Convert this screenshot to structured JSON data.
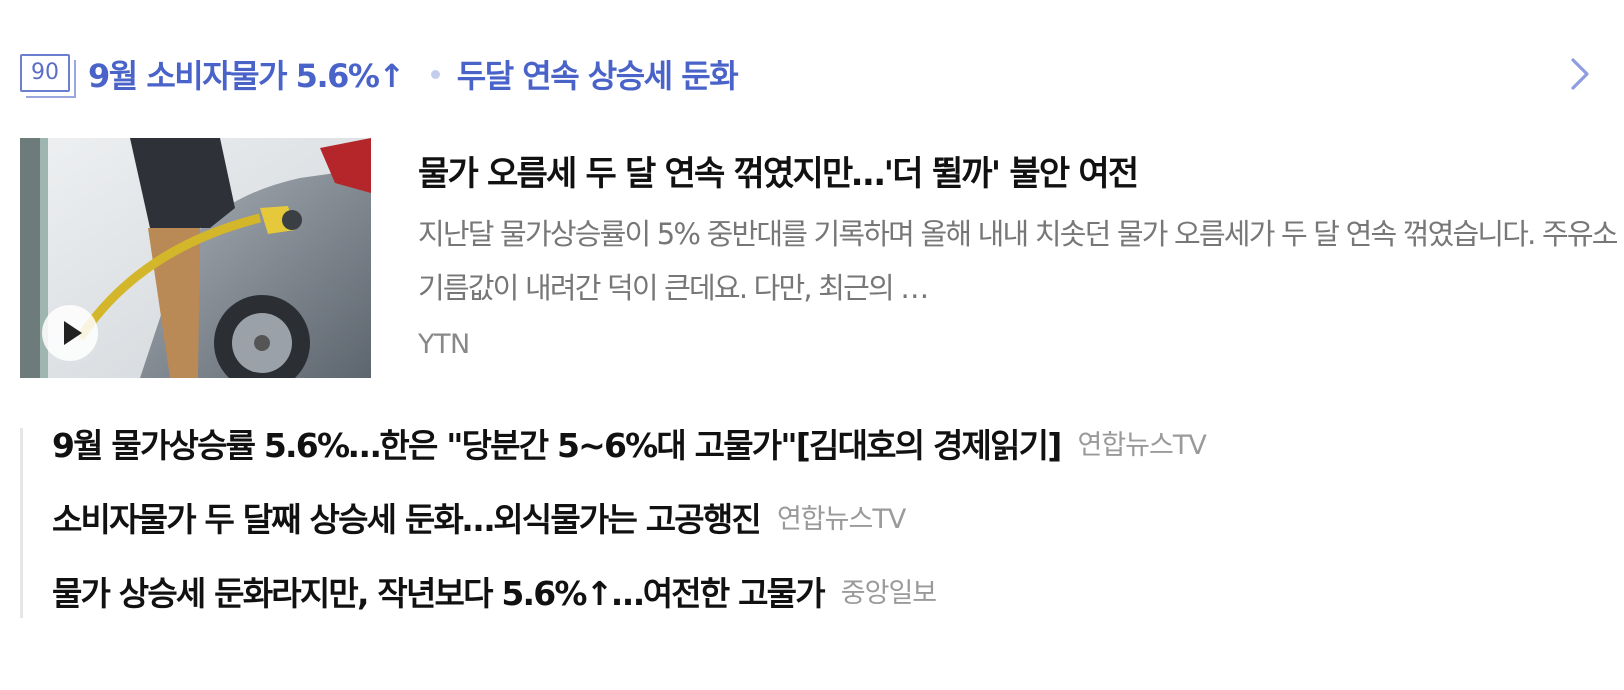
{
  "issue": {
    "badge_number": "90",
    "title": "9월 소비자물가 5.6%↑",
    "subtitle": "두달 연속 상승세 둔화",
    "accent_color": "#4a63c9",
    "more_icon": "chevron-right-icon"
  },
  "main_article": {
    "title": "물가 오름세 두 달 연속 꺾였지만…'더 뛸까' 불안 여전",
    "description": "지난달 물가상승률이 5% 중반대를 기록하며 올해 내내 치솟던 물가 오름세가 두 달 연속 꺾였습니다. 주유소 기름값이 내려간 덕이 큰데요. 다만, 최근의 …",
    "source": "YTN",
    "thumbnail_icon": "play-icon"
  },
  "related_articles": [
    {
      "title": "9월 물가상승률 5.6%…한은 \"당분간 5~6%대 고물가\"[김대호의 경제읽기]",
      "source": "연합뉴스TV"
    },
    {
      "title": "소비자물가 두 달째 상승세 둔화…외식물가는 고공행진",
      "source": "연합뉴스TV"
    },
    {
      "title": "물가 상승세 둔화라지만, 작년보다 5.6%↑…여전한 고물가",
      "source": "중앙일보"
    }
  ]
}
